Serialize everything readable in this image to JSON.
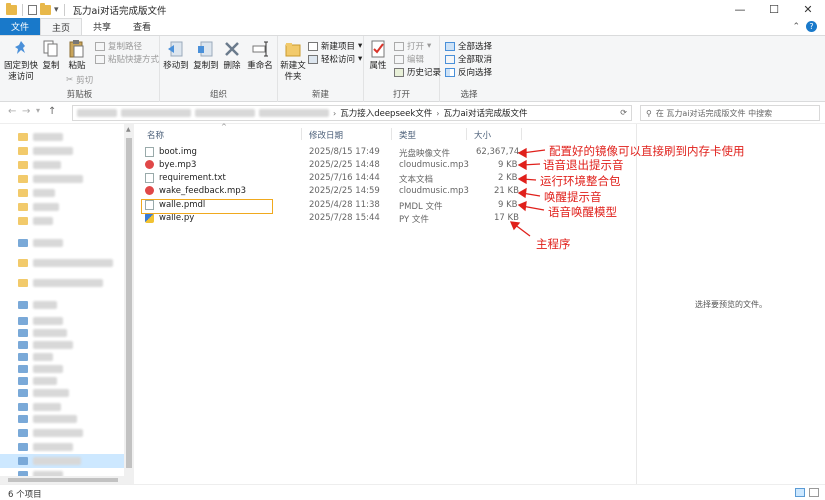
{
  "window": {
    "title": "瓦力ai对话完成版文件",
    "minimize": "—",
    "maximize": "☐",
    "close": "✕"
  },
  "tabs": {
    "file": "文件",
    "home": "主页",
    "share": "共享",
    "view": "查看"
  },
  "ribbon": {
    "clipboard": {
      "label": "剪贴板",
      "pin": "固定到快速访问",
      "copy": "复制",
      "paste": "粘贴",
      "copy_path": "复制路径",
      "paste_shortcut": "粘贴快捷方式",
      "cut": "剪切"
    },
    "organize": {
      "label": "组织",
      "move_to": "移动到",
      "copy_to": "复制到",
      "delete": "删除",
      "rename": "重命名"
    },
    "new": {
      "label": "新建",
      "new_folder": "新建文件夹",
      "new_item": "新建项目",
      "easy_access": "轻松访问"
    },
    "open": {
      "label": "打开",
      "properties": "属性",
      "open": "打开",
      "edit": "编辑",
      "history": "历史记录"
    },
    "select": {
      "label": "选择",
      "select_all": "全部选择",
      "select_none": "全部取消",
      "invert": "反向选择"
    }
  },
  "address": {
    "crumbs": [
      "瓦力接入deepseek文件",
      "瓦力ai对话完成版文件"
    ],
    "search_placeholder": "在 瓦力ai对话完成版文件 中搜索"
  },
  "columns": {
    "name": "名称",
    "date": "修改日期",
    "type": "类型",
    "size": "大小"
  },
  "files": [
    {
      "name": "boot.img",
      "date": "2025/8/15 17:49",
      "type": "光盘映像文件",
      "size": "62,367,74..."
    },
    {
      "name": "bye.mp3",
      "date": "2025/2/25 14:48",
      "type": "cloudmusic.mp3",
      "size": "9 KB"
    },
    {
      "name": "requirement.txt",
      "date": "2025/7/16 14:44",
      "type": "文本文档",
      "size": "2 KB"
    },
    {
      "name": "wake_feedback.mp3",
      "date": "2025/2/25 14:59",
      "type": "cloudmusic.mp3",
      "size": "21 KB"
    },
    {
      "name": "walle.pmdl",
      "date": "2025/4/28 11:38",
      "type": "PMDL 文件",
      "size": "9 KB"
    },
    {
      "name": "walle.py",
      "date": "2025/7/28 15:44",
      "type": "PY 文件",
      "size": "17 KB"
    }
  ],
  "annotations": {
    "boot": "配置好的镜像可以直接刷到内存卡使用",
    "bye": "语音退出提示音",
    "requirement": "运行环境整合包",
    "wake_feedback": "唤醒提示音",
    "pmdl": "语音唤醒模型",
    "main": "主程序",
    "color": "#e0201b"
  },
  "preview": {
    "message": "选择要预览的文件。"
  },
  "status": {
    "count": "6 个项目"
  },
  "colors": {
    "file_tab": "#1979ca",
    "highlight_box": "#f0a91e",
    "selection": "#cde8ff"
  }
}
